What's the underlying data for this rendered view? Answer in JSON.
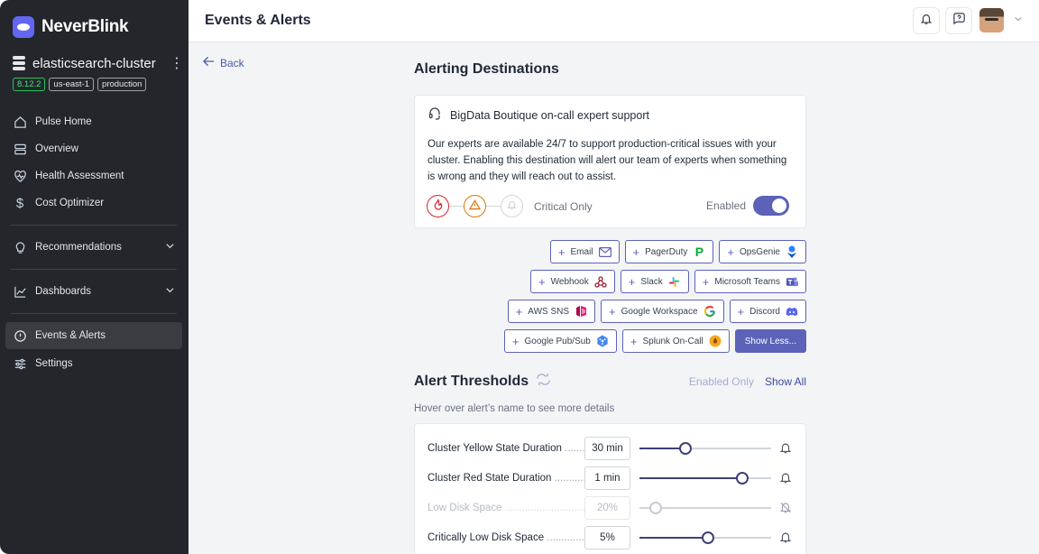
{
  "app": {
    "brand": "NeverBlink"
  },
  "cluster": {
    "name": "elasticsearch-cluster",
    "tags": [
      "8.12.2",
      "us-east-1",
      "production"
    ]
  },
  "sidebar": {
    "items": [
      {
        "label": "Pulse Home",
        "icon": "home-icon"
      },
      {
        "label": "Overview",
        "icon": "server-icon"
      },
      {
        "label": "Health Assessment",
        "icon": "heart-icon"
      },
      {
        "label": "Cost Optimizer",
        "icon": "dollar-icon"
      },
      {
        "label": "Recommendations",
        "icon": "lightbulb-icon"
      },
      {
        "label": "Dashboards",
        "icon": "chart-icon"
      },
      {
        "label": "Events & Alerts",
        "icon": "alert-circle-icon"
      },
      {
        "label": "Settings",
        "icon": "sliders-icon"
      }
    ]
  },
  "header": {
    "title": "Events & Alerts"
  },
  "main": {
    "back_label": "Back",
    "destinations_title": "Alerting Destinations",
    "expert": {
      "title": "BigData Boutique on-call expert support",
      "description": "Our experts are available 24/7 to support production-critical issues with your cluster. Enabling this destination will alert our team of experts when something is wrong and they will reach out to assist.",
      "level_label": "Critical Only",
      "enabled_label": "Enabled",
      "enabled": true
    },
    "destinations": [
      {
        "label": "Email",
        "icon": "mail-icon"
      },
      {
        "label": "PagerDuty",
        "icon": "pagerduty-icon"
      },
      {
        "label": "OpsGenie",
        "icon": "opsgenie-icon"
      },
      {
        "label": "Webhook",
        "icon": "webhook-icon"
      },
      {
        "label": "Slack",
        "icon": "slack-icon"
      },
      {
        "label": "Microsoft Teams",
        "icon": "teams-icon"
      },
      {
        "label": "AWS SNS",
        "icon": "aws-sns-icon"
      },
      {
        "label": "Google Workspace",
        "icon": "google-icon"
      },
      {
        "label": "Discord",
        "icon": "discord-icon"
      },
      {
        "label": "Google Pub/Sub",
        "icon": "pubsub-icon"
      },
      {
        "label": "Splunk On-Call",
        "icon": "splunk-icon"
      }
    ],
    "show_less_label": "Show Less...",
    "thresholds_title": "Alert Thresholds",
    "filter_enabled_only": "Enabled Only",
    "filter_show_all": "Show All",
    "hint": "Hover over alert’s name to see more details",
    "thresholds": [
      {
        "name": "Cluster Yellow State Duration",
        "value": "30 min",
        "level": 0.35,
        "enabled": true
      },
      {
        "name": "Cluster Red State Duration",
        "value": "1 min",
        "level": 0.78,
        "enabled": true
      },
      {
        "name": "Low Disk Space",
        "value": "20%",
        "level": 0.12,
        "enabled": false
      },
      {
        "name": "Critically Low Disk Space",
        "value": "5%",
        "level": 0.52,
        "enabled": true
      }
    ]
  },
  "colors": {
    "accent": "#5b62b8",
    "sidebar": "#24262b",
    "critical": "#dc2626",
    "warning": "#d97706"
  }
}
